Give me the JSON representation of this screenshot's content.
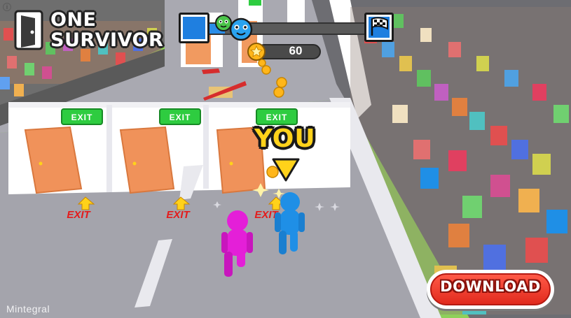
{
  "game": {
    "logo_line1": "ONE",
    "logo_line2": "SURVIVOR",
    "coins": "60",
    "player_label": "YOU",
    "door_sign": "EXIT",
    "floor_marker": "EXIT",
    "download_label": "DOWNLOAD",
    "watermark": "Mintegral",
    "info": "i",
    "progress": 0.1
  },
  "icons": {
    "logo": "door-icon",
    "coin": "star-coin-icon",
    "finish": "checkered-flag-icon",
    "player_avatar": "blue-character-face-icon",
    "rival_avatar": "green-character-face-icon",
    "marker": "down-arrow-icon"
  },
  "colors": {
    "player": "#1f8fe6",
    "rival": "#e41fd8",
    "exit_sign": "#2ecc40",
    "floor_exit": "#e41b1b",
    "arrow": "#ffd21a",
    "download": "#e8321f"
  }
}
